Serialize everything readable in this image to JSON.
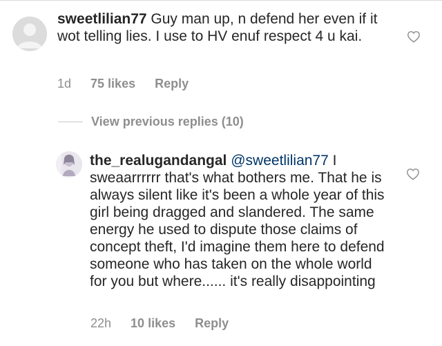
{
  "comment": {
    "username": "sweetlilian77",
    "text": "Guy man up, n defend her even if it wot telling lies. I use to HV enuf respect 4 u kai.",
    "time": "1d",
    "likes": "75 likes",
    "reply_label": "Reply",
    "avatar_icon": "default-avatar-icon",
    "like_icon": "heart-outline-icon"
  },
  "view_replies": {
    "label": "View previous replies (10)"
  },
  "reply": {
    "username": "the_realugandangal",
    "mention": "@sweetlilian77",
    "text": "I sweaarrrrrr that's what bothers me. That he is always silent like it's been a whole year of this girl being dragged and slandered. The same energy he used to dispute those claims of concept theft, I'd imagine them here to defend someone who has taken on the whole world for you but where...... it's really disappointing",
    "time": "22h",
    "likes": "10 likes",
    "reply_label": "Reply",
    "avatar_icon": "profile-photo",
    "like_icon": "heart-outline-icon"
  },
  "colors": {
    "text": "#262626",
    "muted": "#8e8e8e",
    "mention": "#003569",
    "divider": "#dbdbdb"
  }
}
